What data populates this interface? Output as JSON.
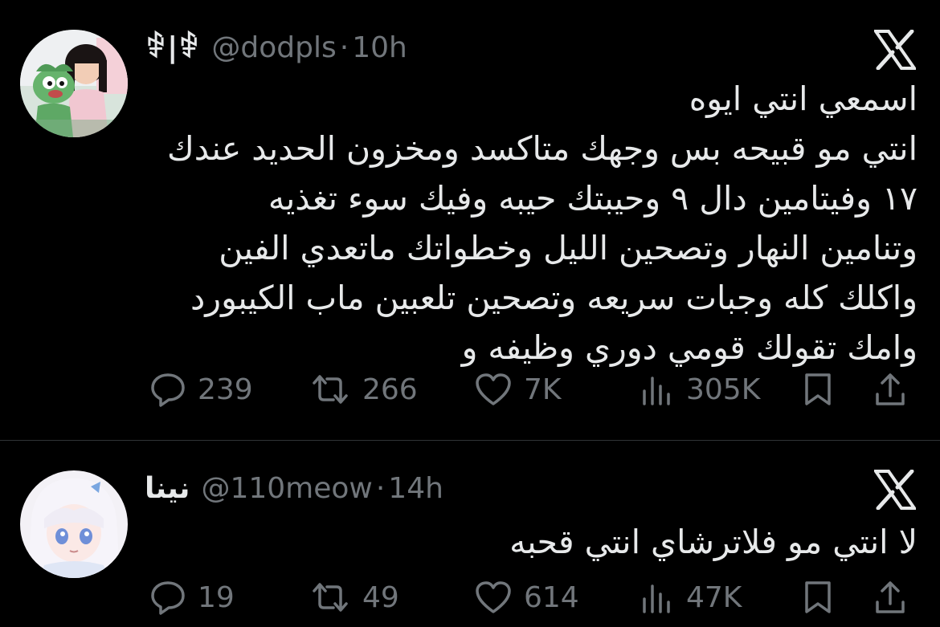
{
  "tweets": [
    {
      "display_name": "ꒆ|ꒆ",
      "handle": "@dodpls",
      "separator": "·",
      "time": "10h",
      "lines": [
        "اسمعي انتي ايوه",
        "انتي مو قبيحه بس وجهك متاكسد ومخزون الحديد عندك",
        "١٧ وفيتامين دال ٩ وحيبتك حيبه وفيك سوء تغذيه",
        "وتنامين النهار وتصحين الليل وخطواتك ماتعدي الفين",
        "واكلك كله وجبات سريعه وتصحين تلعبين ماب الكيبورد",
        "وامك تقولك قومي دوري وظيفه و"
      ],
      "replies": "239",
      "retweets": "266",
      "likes": "7K",
      "views": "305K"
    },
    {
      "display_name": "نينا",
      "handle": "@110meow",
      "separator": "·",
      "time": "14h",
      "lines": [
        "لا انتي مو فلاترشاي انتي قحبه"
      ],
      "replies": "19",
      "retweets": "49",
      "likes": "614",
      "views": "47K"
    }
  ],
  "icons": {
    "brand": "x-logo-icon",
    "reply": "reply-icon",
    "retweet": "retweet-icon",
    "like": "heart-icon",
    "views": "views-icon",
    "bookmark": "bookmark-icon",
    "share": "share-icon"
  },
  "colors": {
    "background": "#000000",
    "text": "#e7e9ea",
    "muted": "#71767b",
    "divider": "#2f3336"
  }
}
